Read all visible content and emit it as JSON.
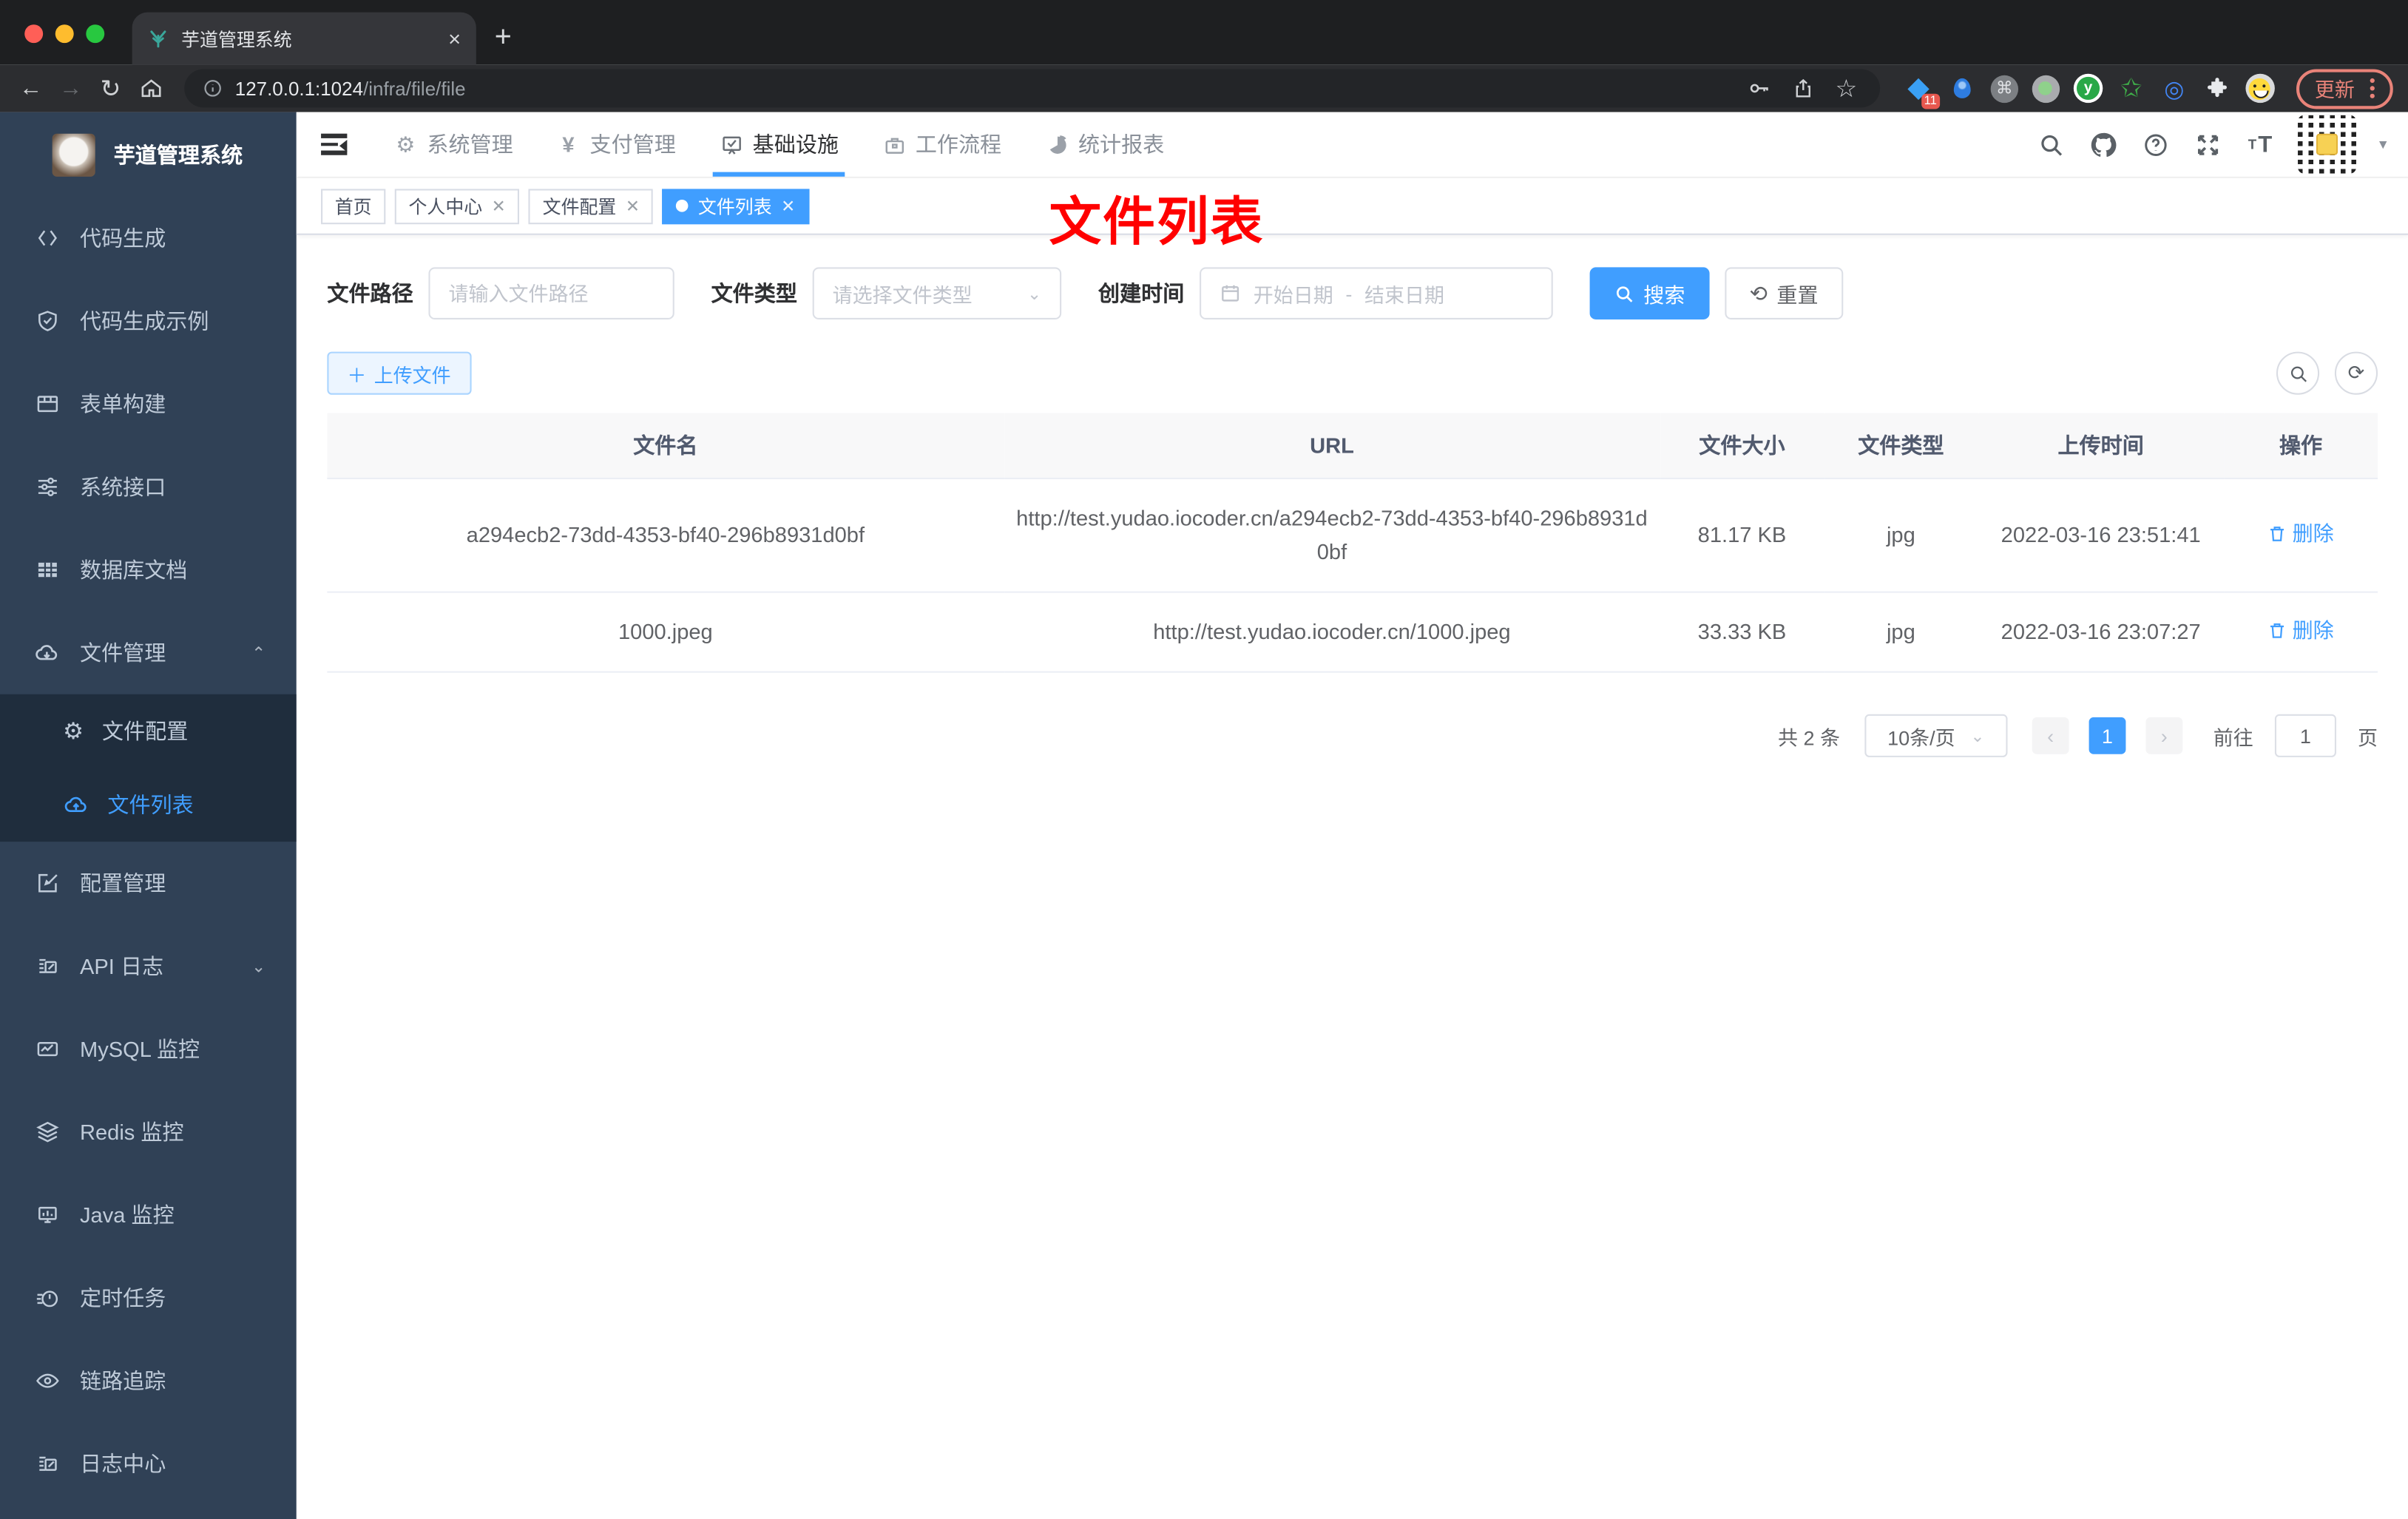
{
  "browser": {
    "tab_title": "芋道管理系统",
    "new_tab": "+",
    "close_glyph": "×",
    "url_host": "127.0.0.1:1024",
    "url_path": "/infra/file/file",
    "extension_badge": "11",
    "y_extension": "y",
    "update_label": "更新"
  },
  "sidebar": {
    "title": "芋道管理系统",
    "items": [
      {
        "icon": "code-icon",
        "label": "代码生成"
      },
      {
        "icon": "shield-check-icon",
        "label": "代码生成示例"
      },
      {
        "icon": "form-table-icon",
        "label": "表单构建"
      },
      {
        "icon": "sliders-icon",
        "label": "系统接口"
      },
      {
        "icon": "db-grid-icon",
        "label": "数据库文档"
      },
      {
        "icon": "cloud-download-icon",
        "label": "文件管理"
      },
      {
        "icon": "gear-icon",
        "label": "文件配置"
      },
      {
        "icon": "cloud-upload-icon",
        "label": "文件列表"
      },
      {
        "icon": "edit-icon",
        "label": "配置管理"
      },
      {
        "icon": "log-edit-icon",
        "label": "API 日志"
      },
      {
        "icon": "mysql-monitor-icon",
        "label": "MySQL 监控"
      },
      {
        "icon": "redis-layers-icon",
        "label": "Redis 监控"
      },
      {
        "icon": "java-monitor-icon",
        "label": "Java 监控"
      },
      {
        "icon": "timer-icon",
        "label": "定时任务"
      },
      {
        "icon": "eye-icon",
        "label": "链路追踪"
      },
      {
        "icon": "log-center-icon",
        "label": "日志中心"
      }
    ]
  },
  "nav": {
    "items": [
      {
        "icon": "gear-icon",
        "label": "系统管理"
      },
      {
        "icon": "yen-icon",
        "label": "支付管理"
      },
      {
        "icon": "monitor-check-icon",
        "label": "基础设施"
      },
      {
        "icon": "briefcase-icon",
        "label": "工作流程"
      },
      {
        "icon": "pie-chart-icon",
        "label": "统计报表"
      }
    ],
    "yen_glyph": "¥"
  },
  "tags": {
    "items": [
      {
        "label": "首页"
      },
      {
        "label": "个人中心"
      },
      {
        "label": "文件配置"
      },
      {
        "label": "文件列表"
      }
    ]
  },
  "annotation": {
    "text": "文件列表",
    "color": "#ff0000"
  },
  "filters": {
    "path_label": "文件路径",
    "path_placeholder": "请输入文件路径",
    "type_label": "文件类型",
    "type_placeholder": "请选择文件类型",
    "date_label": "创建时间",
    "date_start": "开始日期",
    "date_sep": "-",
    "date_end": "结束日期",
    "search_label": "搜索",
    "reset_label": "重置"
  },
  "toolbar": {
    "upload_label": "上传文件",
    "plus_glyph": "＋"
  },
  "table": {
    "headers": [
      "文件名",
      "URL",
      "文件大小",
      "文件类型",
      "上传时间",
      "操作"
    ],
    "rows": [
      {
        "name": "a294ecb2-73dd-4353-bf40-296b8931d0bf",
        "url": "http://test.yudao.iocoder.cn/a294ecb2-73dd-4353-bf40-296b8931d0bf",
        "size": "81.17 KB",
        "type": "jpg",
        "time": "2022-03-16 23:51:41",
        "action": "删除"
      },
      {
        "name": "1000.jpeg",
        "url": "http://test.yudao.iocoder.cn/1000.jpeg",
        "size": "33.33 KB",
        "type": "jpg",
        "time": "2022-03-16 23:07:27",
        "action": "删除"
      }
    ]
  },
  "pagination": {
    "total": "共 2 条",
    "page_size": "10条/页",
    "prev": "‹",
    "next": "›",
    "current": "1",
    "goto_label": "前往",
    "goto_value": "1",
    "unit_label": "页"
  },
  "colors": {
    "accent": "#409eff",
    "sidebar_bg": "#304156",
    "submenu_bg": "#1f2d3d",
    "annotation": "#ff0000",
    "update": "#e98379"
  }
}
